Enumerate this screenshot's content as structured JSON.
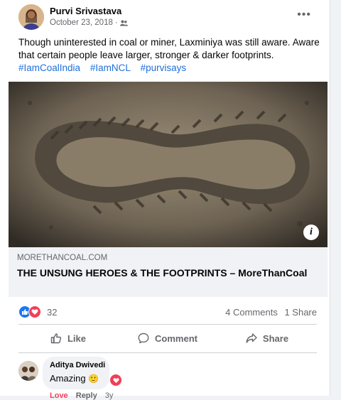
{
  "post": {
    "author": "Purvi Srivastava",
    "date": "October 23, 2018",
    "audience_icon": "friends-icon",
    "more": "•••",
    "text": "Though uninterested in coal or miner, Laxminiya was still aware. Aware that certain people  leave larger, stronger & darker footprints.",
    "hashtags": [
      "#IamCoalIndia",
      "#IamNCL",
      "#purvisays"
    ]
  },
  "link": {
    "domain": "MORETHANCOAL.COM",
    "title": "THE UNSUNG HEROES & THE FOOTPRINTS – MoreThanCoal",
    "info": "i"
  },
  "stats": {
    "reactions": "32",
    "comments": "4 Comments",
    "shares": "1 Share"
  },
  "actions": {
    "like": "Like",
    "comment": "Comment",
    "share": "Share"
  },
  "comment": {
    "name": "Aditya Dwivedi",
    "text": "Amazing",
    "emoji": "🙂",
    "links": [
      "Love",
      "Reply",
      "3y"
    ]
  },
  "colors": {
    "link_blue": "#216fdb",
    "like_blue": "#1877f2",
    "love_red": "#f33e58",
    "muted": "#65676b"
  }
}
